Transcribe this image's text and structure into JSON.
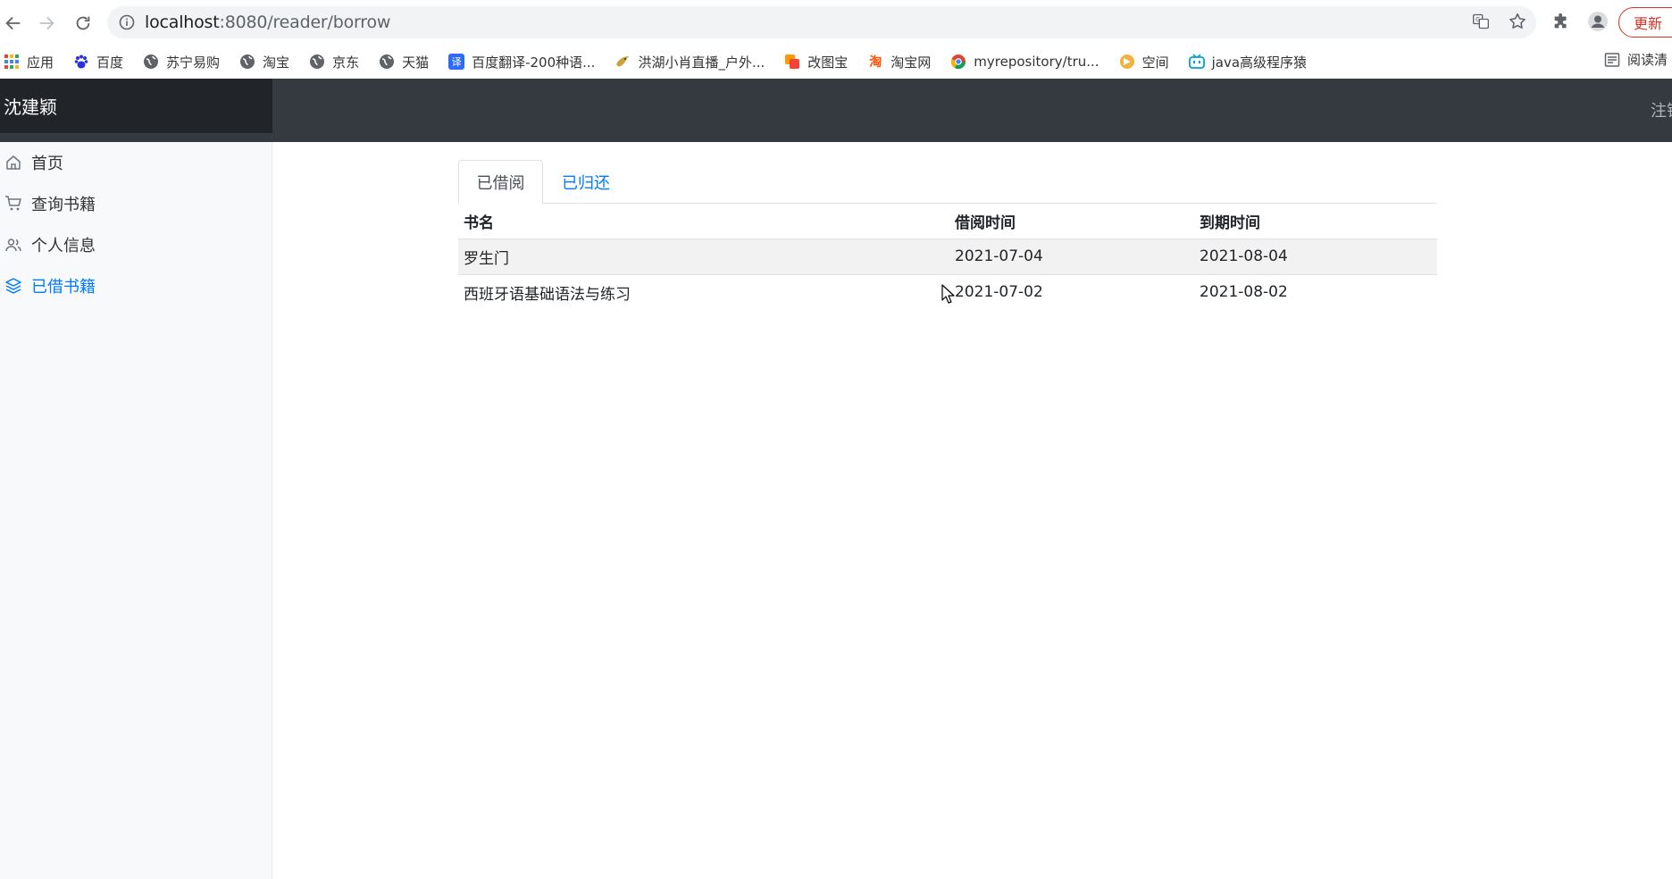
{
  "browser": {
    "url_host": "localhost",
    "url_path": ":8080/reader/borrow",
    "update_label": "更新",
    "bookmarks": [
      {
        "label": "应用",
        "icon": "apps-grid-icon"
      },
      {
        "label": "百度",
        "icon": "baidu-paw-icon"
      },
      {
        "label": "苏宁易购",
        "icon": "globe-icon"
      },
      {
        "label": "淘宝",
        "icon": "globe-icon"
      },
      {
        "label": "京东",
        "icon": "globe-icon"
      },
      {
        "label": "天猫",
        "icon": "globe-icon"
      },
      {
        "label": "百度翻译-200种语...",
        "icon": "translate-icon"
      },
      {
        "label": "洪湖小肖直播_户外...",
        "icon": "bird-icon"
      },
      {
        "label": "改图宝",
        "icon": "gaitubao-icon"
      },
      {
        "label": "淘宝网",
        "icon": "taobao-icon"
      },
      {
        "label": "myrepository/tru...",
        "icon": "chrome-like-icon"
      },
      {
        "label": "空间",
        "icon": "qzone-icon"
      },
      {
        "label": "java高级程序猿",
        "icon": "bilibili-icon"
      }
    ],
    "reading_list_label": "阅读清"
  },
  "header": {
    "brand": "沈建颖",
    "logout_label": "注销"
  },
  "sidebar": {
    "items": [
      {
        "label": "首页",
        "icon": "home-icon"
      },
      {
        "label": "查询书籍",
        "icon": "cart-icon"
      },
      {
        "label": "个人信息",
        "icon": "users-icon"
      },
      {
        "label": "已借书籍",
        "icon": "layers-icon",
        "active": true
      }
    ]
  },
  "tabs": {
    "borrowed": "已借阅",
    "returned": "已归还"
  },
  "table": {
    "columns": [
      "书名",
      "借阅时间",
      "到期时间"
    ],
    "rows": [
      [
        "罗生门",
        "2021-07-04",
        "2021-08-04"
      ],
      [
        "西班牙语基础语法与练习",
        "2021-07-02",
        "2021-08-02"
      ]
    ]
  },
  "colors": {
    "header_bg": "#343a40",
    "brand_bg": "#212529",
    "accent": "#007bff",
    "sidebar_bg": "#f8f9fa"
  }
}
